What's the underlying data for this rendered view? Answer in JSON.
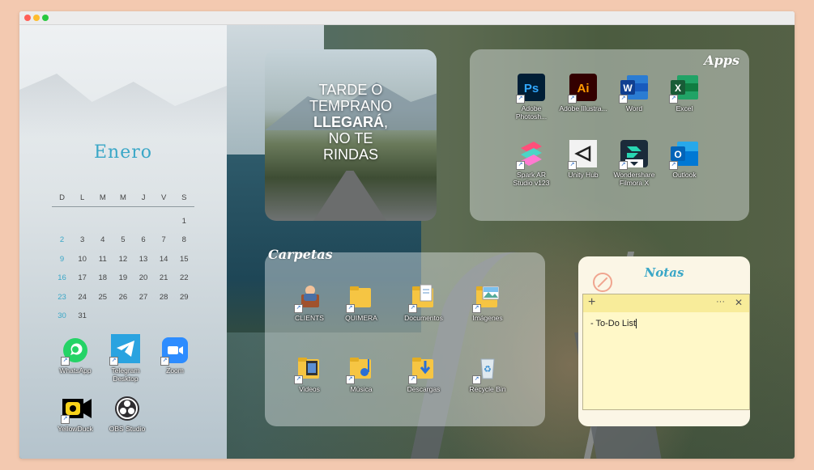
{
  "window": {
    "dots": [
      "#ff5f57",
      "#febc2e",
      "#28c840"
    ]
  },
  "calendar": {
    "month": "Enero",
    "weekdays": [
      "D",
      "L",
      "M",
      "M",
      "J",
      "V",
      "S"
    ],
    "weeks": [
      [
        "",
        "",
        "",
        "",
        "",
        "",
        "1"
      ],
      [
        "2",
        "3",
        "4",
        "5",
        "6",
        "7",
        "8"
      ],
      [
        "9",
        "10",
        "11",
        "12",
        "13",
        "14",
        "15"
      ],
      [
        "16",
        "17",
        "18",
        "19",
        "20",
        "21",
        "22"
      ],
      [
        "23",
        "24",
        "25",
        "26",
        "27",
        "28",
        "29"
      ],
      [
        "30",
        "31",
        "",
        "",
        "",
        "",
        ""
      ]
    ]
  },
  "dock_apps": [
    {
      "label": "WhatsApp",
      "icon": "whatsapp-icon"
    },
    {
      "label": "Telegram Desktop",
      "icon": "telegram-icon"
    },
    {
      "label": "Zoom",
      "icon": "zoom-icon"
    },
    {
      "label": "YellowDuck",
      "icon": "yellowduck-icon"
    },
    {
      "label": "OBS Studio",
      "icon": "obs-icon"
    }
  ],
  "quote": {
    "line1": "TARDE O",
    "line2": "TEMPRANO",
    "line3": "LLEGARÁ",
    "line3_suffix": ",",
    "line4": "NO TE",
    "line5": "RINDAS"
  },
  "apps_panel": {
    "title": "Apps",
    "items": [
      {
        "label": "Adobe Photosh...",
        "icon": "photoshop-icon"
      },
      {
        "label": "Adobe Illustra...",
        "icon": "illustrator-icon"
      },
      {
        "label": "Word",
        "icon": "word-icon"
      },
      {
        "label": "Excel",
        "icon": "excel-icon"
      },
      {
        "label": "Spark AR Studio v123",
        "icon": "spark-ar-icon"
      },
      {
        "label": "Unity Hub",
        "icon": "unity-hub-icon"
      },
      {
        "label": "Wondershare Filmora X",
        "icon": "filmora-icon"
      },
      {
        "label": "Outlook",
        "icon": "outlook-icon"
      }
    ]
  },
  "folders_panel": {
    "title": "Carpetas",
    "items": [
      {
        "label": "CLIENTS",
        "icon": "clients-folder-icon"
      },
      {
        "label": "QUIMERA",
        "icon": "quimera-folder-icon"
      },
      {
        "label": "Documentos",
        "icon": "documents-folder-icon"
      },
      {
        "label": "Imágenes",
        "icon": "images-folder-icon"
      },
      {
        "label": "Videos",
        "icon": "videos-folder-icon"
      },
      {
        "label": "Música",
        "icon": "music-folder-icon"
      },
      {
        "label": "Descargas",
        "icon": "downloads-folder-icon"
      },
      {
        "label": "Recycle Bin",
        "icon": "recycle-bin-icon"
      }
    ]
  },
  "notes": {
    "title": "Notas",
    "add": "+",
    "more": "···",
    "close": "✕",
    "content": "- To-Do List"
  }
}
